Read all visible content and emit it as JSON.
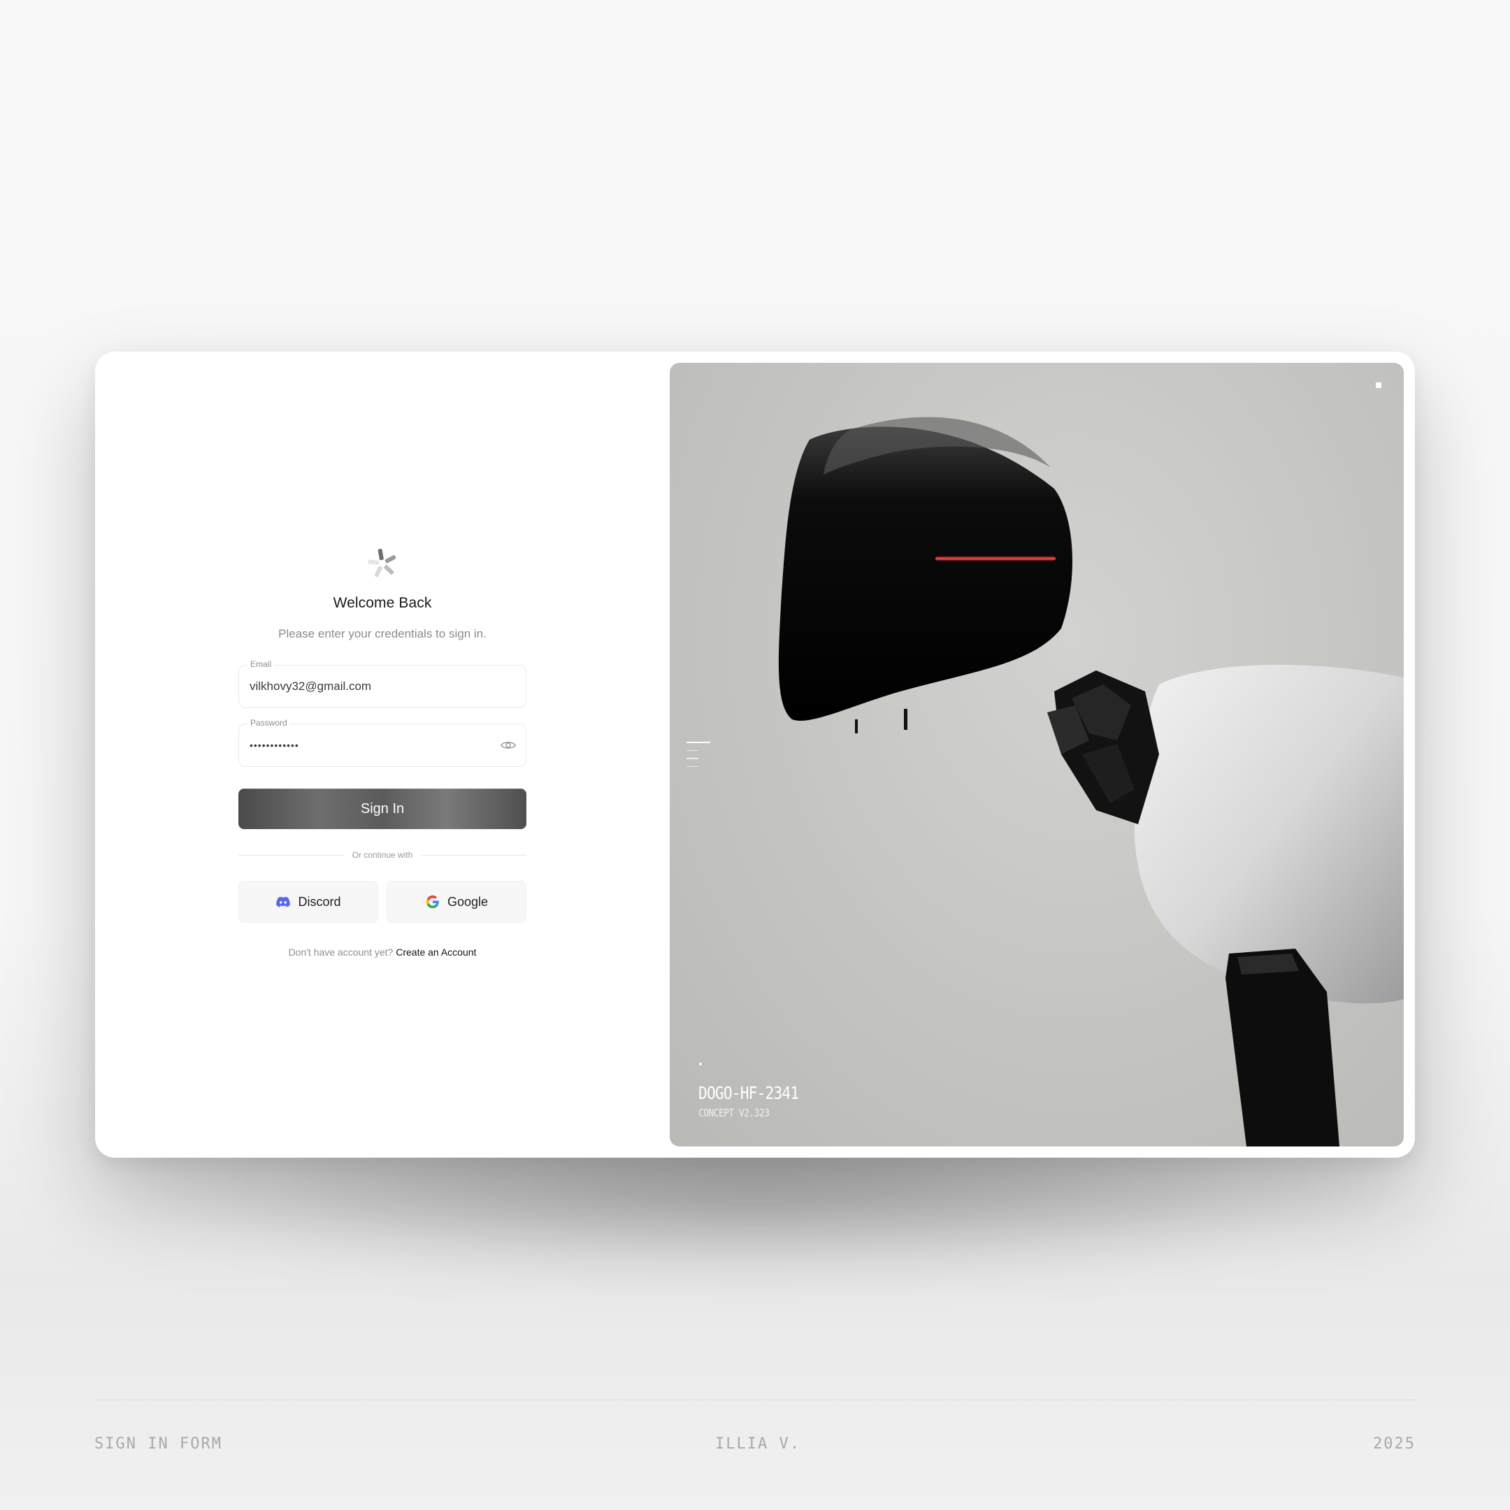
{
  "form": {
    "title": "Welcome Back",
    "subtitle": "Please enter your credentials to sign in.",
    "email_label": "Email",
    "email_value": "vilkhovy32@gmail.com",
    "password_label": "Password",
    "password_value": "••••••••••••",
    "signin_label": "Sign In",
    "divider_text": "Or continue with",
    "discord_label": "Discord",
    "google_label": "Google",
    "signup_prompt": "Don't have account yet?",
    "signup_link": "Create an Account"
  },
  "panel": {
    "model_code": "DOGO-HF-2341",
    "concept_version": "CONCEPT V2.323"
  },
  "footer": {
    "left": "SIGN IN FORM",
    "center": "ILLIA V.",
    "right": "2025"
  },
  "icons": {
    "logo": "snowflake-logo-icon",
    "eye": "eye-icon",
    "discord": "discord-icon",
    "google": "google-icon"
  },
  "colors": {
    "accent_red": "#e23b3b",
    "discord_blue": "#5865f2",
    "panel_bg": "#c4c4c1"
  }
}
